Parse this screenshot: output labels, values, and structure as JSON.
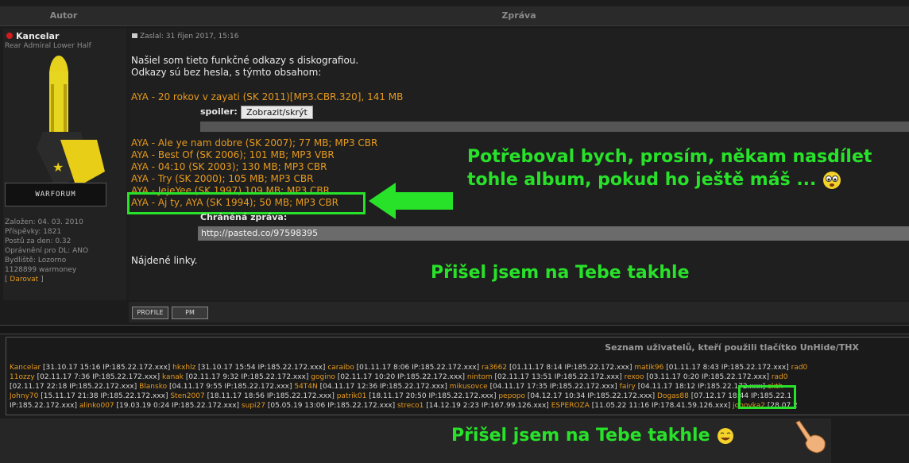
{
  "header": {
    "author_col": "Autor",
    "message_col": "Zpráva"
  },
  "author": {
    "name": "Kancelar",
    "rank": "Rear Admiral Lower Half",
    "banner": "WARFORUM",
    "stats": [
      "Založen: 04. 03. 2010",
      "Příspěvky: 1821",
      "Postů za den: 0.32",
      "Oprávnění pro DL: ANO",
      "Bydliště: Lozorno",
      "1128899 warmoney"
    ],
    "donate": "Darovat",
    "donate_prefix": "[",
    "donate_suffix": "]"
  },
  "post": {
    "info": "Zaslal: 31 říjen 2017, 15:16",
    "intro1": "Našiel som tieto funkčné odkazy s diskografiou.",
    "intro2": "Odkazy sú bez hesla, s týmto obsahom:",
    "first_link": "AYA - 20 rokov v zayati (SK 2011)[MP3.CBR.320], 141 MB",
    "spoiler_label": "spoiler:",
    "spoiler_button": "Zobrazit/skrýt",
    "list": [
      "AYA - Ale ye nam dobre (SK 2007); 77 MB; MP3 CBR",
      "AYA - Best Of (SK 2006); 101 MB; MP3 VBR",
      "AYA - 04:10 (SK 2003); 130 MB; MP3 CBR",
      "AYA - Try (SK 2000); 105 MB; MP3 CBR",
      "AYA - JejeYee (SK 1997) 109 MB; MP3 CBR",
      "AYA - Aj ty, AYA (SK 1994); 50 MB; MP3 CBR"
    ],
    "protected_label": "Chráněná zpráva:",
    "protected_link": "http://pasted.co/97598395",
    "found": "Nájdené linky."
  },
  "annotations": {
    "request": "Potřeboval bych, prosím,  někam nasdílet tohle album, pokud ho ještě máš ...",
    "found1": "Přišel jsem na Tebe takhle",
    "found2": "Přišel jsem na Tebe takhle"
  },
  "buttons": {
    "profile": "PROFILE",
    "pm": "PM"
  },
  "users_panel": {
    "title": "Seznam uživatelů, kteří použili tlačítko UnHide/THX",
    "rows": [
      [
        [
          "Kancelar",
          "[31.10.17 15:16 IP:185.22.172.xxx]"
        ],
        [
          "hkxhlz",
          "[31.10.17 15:54 IP:185.22.172.xxx]"
        ],
        [
          "caraibo",
          "[01.11.17 8:06 IP:185.22.172.xxx]"
        ],
        [
          "ra3662",
          "[01.11.17 8:14 IP:185.22.172.xxx]"
        ],
        [
          "matik96",
          "[01.11.17 8:43 IP:185.22.172.xxx]"
        ],
        [
          "rad0",
          ""
        ]
      ],
      [
        [
          "11ozzy",
          "[02.11.17 7:36 IP:185.22.172.xxx]"
        ],
        [
          "kanak",
          "[02.11.17 9:32 IP:185.22.172.xxx]"
        ],
        [
          "gogino",
          "[02.11.17 10:20 IP:185.22.172.xxx]"
        ],
        [
          "nintom",
          "[02.11.17 13:51 IP:185.22.172.xxx]"
        ],
        [
          "rexoo",
          "[03.11.17 0:20 IP:185.22.172.xxx]"
        ],
        [
          "rad0",
          ""
        ]
      ],
      [
        [
          "",
          "[02.11.17 22:18 IP:185.22.172.xxx]"
        ],
        [
          "Blansko",
          "[04.11.17 9:55 IP:185.22.172.xxx]"
        ],
        [
          "54T4N",
          "[04.11.17 12:36 IP:185.22.172.xxx]"
        ],
        [
          "mikusovce",
          "[04.11.17 17:35 IP:185.22.172.xxx]"
        ],
        [
          "fairy",
          "[04.11.17 18:12 IP:185.22.172.xxx]"
        ],
        [
          "ckth",
          ""
        ]
      ],
      [
        [
          "Johny70",
          "[15.11.17 21:38 IP:185.22.172.xxx]"
        ],
        [
          "Sten2007",
          "[18.11.17 18:56 IP:185.22.172.xxx]"
        ],
        [
          "patrik01",
          "[18.11.17 20:50 IP:185.22.172.xxx]"
        ],
        [
          "pepopo",
          "[04.12.17 10:34 IP:185.22.172.xxx]"
        ],
        [
          "Dogas88",
          "[07.12.17 18:44 IP:185.22.1"
        ]
      ],
      [
        [
          "",
          "IP:185.22.172.xxx]"
        ],
        [
          "alinko007",
          "[19.03.19 0:24 IP:185.22.172.xxx]"
        ],
        [
          "supi27",
          "[05.05.19 13:06 IP:185.22.172.xxx]"
        ],
        [
          "streco1",
          "[14.12.19 2:23 IP:167.99.126.xxx]"
        ],
        [
          "ESPEROZA",
          "[11.05.22 11:16 IP:178.41.59.126.xxx]"
        ],
        [
          "jobovka2",
          "[28.07.2"
        ]
      ]
    ]
  },
  "colors": {
    "accent_green": "#28e22a",
    "link_orange": "#e69a1e"
  }
}
